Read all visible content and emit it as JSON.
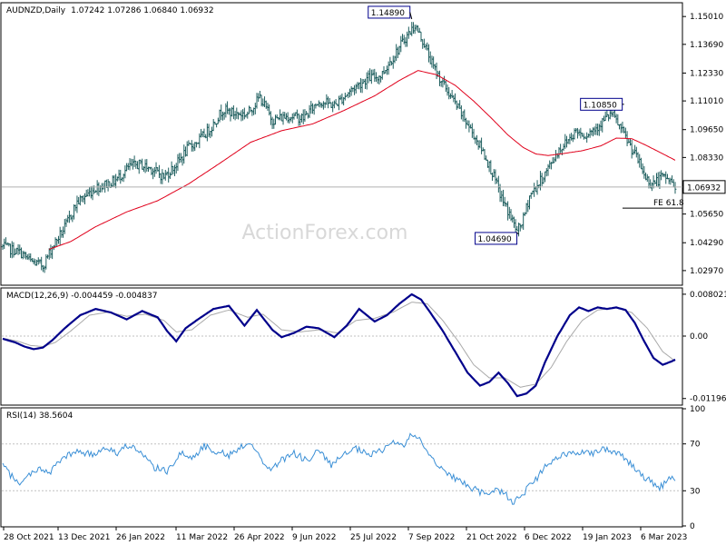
{
  "header": {
    "symbol": "AUDNZD,Daily",
    "ohlc": "1.07242 1.07286 1.06840 1.06932"
  },
  "watermark": "ActionForex.com",
  "colors": {
    "price_bar": "#1f5f5f",
    "ma": "#e0001b",
    "macd_line": "#00008b",
    "signal_line": "#a9a9a9",
    "rsi_line": "#3a8fd6",
    "grid": "#c0c0c0",
    "frame": "#000000",
    "label_border": "#00008b"
  },
  "chart_data": [
    {
      "type": "candlestick",
      "title": "AUDNZD,Daily",
      "ylim": [
        1.0232,
        1.1562
      ],
      "y_ticks": [
        "1.15010",
        "1.13690",
        "1.12330",
        "1.11010",
        "1.09650",
        "1.08330",
        "1.06970",
        "1.05650",
        "1.04290",
        "1.02970"
      ],
      "x_ticks": [
        "28 Oct 2021",
        "13 Dec 2021",
        "26 Jan 2022",
        "11 Mar 2022",
        "26 Apr 2022",
        "9 Jun 2022",
        "25 Jul 2022",
        "7 Sep 2022",
        "21 Oct 2022",
        "6 Dec 2022",
        "19 Jan 2023",
        "6 Mar 2023"
      ],
      "close_keypoints": [
        [
          0,
          1.041
        ],
        [
          12,
          1.038
        ],
        [
          18,
          1.034
        ],
        [
          26,
          1.032
        ],
        [
          32,
          1.041
        ],
        [
          40,
          1.05
        ],
        [
          48,
          1.062
        ],
        [
          60,
          1.069
        ],
        [
          72,
          1.072
        ],
        [
          82,
          1.079
        ],
        [
          88,
          1.08
        ],
        [
          96,
          1.078
        ],
        [
          104,
          1.074
        ],
        [
          112,
          1.08
        ],
        [
          120,
          1.088
        ],
        [
          126,
          1.091
        ],
        [
          134,
          1.097
        ],
        [
          142,
          1.106
        ],
        [
          150,
          1.104
        ],
        [
          158,
          1.104
        ],
        [
          166,
          1.112
        ],
        [
          174,
          1.101
        ],
        [
          184,
          1.103
        ],
        [
          194,
          1.102
        ],
        [
          204,
          1.11
        ],
        [
          214,
          1.108
        ],
        [
          226,
          1.116
        ],
        [
          236,
          1.121
        ],
        [
          244,
          1.122
        ],
        [
          252,
          1.131
        ],
        [
          260,
          1.14
        ],
        [
          266,
          1.146
        ],
        [
          272,
          1.137
        ],
        [
          278,
          1.126
        ],
        [
          286,
          1.116
        ],
        [
          296,
          1.104
        ],
        [
          304,
          1.094
        ],
        [
          310,
          1.086
        ],
        [
          316,
          1.076
        ],
        [
          322,
          1.064
        ],
        [
          328,
          1.055
        ],
        [
          332,
          1.048
        ],
        [
          336,
          1.054
        ],
        [
          340,
          1.065
        ],
        [
          346,
          1.071
        ],
        [
          352,
          1.078
        ],
        [
          358,
          1.086
        ],
        [
          364,
          1.091
        ],
        [
          370,
          1.096
        ],
        [
          376,
          1.094
        ],
        [
          382,
          1.097
        ],
        [
          388,
          1.101
        ],
        [
          393,
          1.104
        ],
        [
          398,
          1.098
        ],
        [
          404,
          1.09
        ],
        [
          410,
          1.082
        ],
        [
          414,
          1.075
        ],
        [
          418,
          1.071
        ],
        [
          422,
          1.072
        ],
        [
          426,
          1.074
        ],
        [
          430,
          1.073
        ],
        [
          434,
          1.069
        ]
      ],
      "ma_keypoints": [
        [
          30,
          1.0398
        ],
        [
          44,
          1.0435
        ],
        [
          60,
          1.0505
        ],
        [
          80,
          1.0575
        ],
        [
          100,
          1.0628
        ],
        [
          120,
          1.0708
        ],
        [
          140,
          1.0805
        ],
        [
          160,
          1.0905
        ],
        [
          180,
          1.096
        ],
        [
          200,
          1.0992
        ],
        [
          220,
          1.1055
        ],
        [
          240,
          1.1125
        ],
        [
          256,
          1.1198
        ],
        [
          268,
          1.1245
        ],
        [
          280,
          1.1225
        ],
        [
          292,
          1.1175
        ],
        [
          304,
          1.11
        ],
        [
          316,
          1.1015
        ],
        [
          326,
          1.094
        ],
        [
          336,
          1.088
        ],
        [
          344,
          1.085
        ],
        [
          352,
          1.0842
        ],
        [
          362,
          1.0852
        ],
        [
          374,
          1.0865
        ],
        [
          386,
          1.0888
        ],
        [
          396,
          1.0925
        ],
        [
          406,
          1.0922
        ],
        [
          414,
          1.0895
        ],
        [
          424,
          1.0858
        ],
        [
          434,
          1.082
        ]
      ],
      "series": [
        {
          "name": "",
          "kind": "ohlc_bars"
        },
        {
          "name": "",
          "kind": "moving_average"
        }
      ],
      "price_labels": [
        {
          "text": "1.14890",
          "bar": 264,
          "value": 1.1489
        },
        {
          "text": "1.10850",
          "bar": 401,
          "value": 1.1085
        },
        {
          "text": "1.04690",
          "bar": 333,
          "value": 1.0469
        }
      ],
      "current_price": "1.06932",
      "current_value": 1.06932,
      "fe_label": "FE 61.8",
      "fe_value": 1.0593,
      "grid": false
    },
    {
      "type": "line",
      "title": "MACD(12,26,9) -0.004459 -0.004837",
      "ylim": [
        -0.01305,
        0.00905
      ],
      "y_ticks": [
        "0.008021",
        "0.00",
        "-0.011962"
      ],
      "y_tick_values": [
        0.008021,
        0.0,
        -0.011962
      ],
      "macd_keypoints": [
        [
          0,
          -0.0005
        ],
        [
          8,
          -0.0012
        ],
        [
          14,
          -0.002
        ],
        [
          20,
          -0.0025
        ],
        [
          26,
          -0.0022
        ],
        [
          32,
          -0.0008
        ],
        [
          40,
          0.0015
        ],
        [
          50,
          0.004
        ],
        [
          60,
          0.0052
        ],
        [
          70,
          0.0045
        ],
        [
          80,
          0.0032
        ],
        [
          90,
          0.0048
        ],
        [
          100,
          0.0036
        ],
        [
          106,
          0.001
        ],
        [
          112,
          -0.001
        ],
        [
          118,
          0.0015
        ],
        [
          126,
          0.0032
        ],
        [
          136,
          0.0052
        ],
        [
          146,
          0.0058
        ],
        [
          156,
          0.002
        ],
        [
          164,
          0.005
        ],
        [
          174,
          0.0012
        ],
        [
          180,
          -0.0002
        ],
        [
          188,
          0.0006
        ],
        [
          196,
          0.0018
        ],
        [
          204,
          0.0015
        ],
        [
          214,
          -0.0002
        ],
        [
          222,
          0.002
        ],
        [
          230,
          0.0052
        ],
        [
          240,
          0.0028
        ],
        [
          248,
          0.004
        ],
        [
          256,
          0.0062
        ],
        [
          264,
          0.008
        ],
        [
          270,
          0.007
        ],
        [
          276,
          0.0045
        ],
        [
          284,
          0.001
        ],
        [
          292,
          -0.003
        ],
        [
          300,
          -0.007
        ],
        [
          308,
          -0.0095
        ],
        [
          314,
          -0.0088
        ],
        [
          320,
          -0.007
        ],
        [
          326,
          -0.009
        ],
        [
          332,
          -0.0115
        ],
        [
          338,
          -0.011
        ],
        [
          344,
          -0.0095
        ],
        [
          350,
          -0.005
        ],
        [
          358,
          0.0
        ],
        [
          366,
          0.004
        ],
        [
          372,
          0.0055
        ],
        [
          378,
          0.0048
        ],
        [
          384,
          0.0055
        ],
        [
          390,
          0.0052
        ],
        [
          396,
          0.0055
        ],
        [
          402,
          0.005
        ],
        [
          408,
          0.0025
        ],
        [
          414,
          -0.001
        ],
        [
          420,
          -0.0042
        ],
        [
          426,
          -0.0055
        ],
        [
          432,
          -0.0048
        ],
        [
          434,
          -0.0045
        ]
      ],
      "signal_keypoints": [
        [
          0,
          -0.0004
        ],
        [
          10,
          -0.001
        ],
        [
          18,
          -0.0018
        ],
        [
          26,
          -0.002
        ],
        [
          34,
          -0.0012
        ],
        [
          44,
          0.001
        ],
        [
          56,
          0.004
        ],
        [
          68,
          0.0046
        ],
        [
          80,
          0.0038
        ],
        [
          92,
          0.0042
        ],
        [
          104,
          0.003
        ],
        [
          112,
          0.0008
        ],
        [
          122,
          0.0012
        ],
        [
          134,
          0.004
        ],
        [
          146,
          0.005
        ],
        [
          158,
          0.0036
        ],
        [
          168,
          0.0042
        ],
        [
          180,
          0.0012
        ],
        [
          192,
          0.0008
        ],
        [
          204,
          0.0012
        ],
        [
          216,
          0.0006
        ],
        [
          228,
          0.003
        ],
        [
          240,
          0.0034
        ],
        [
          252,
          0.0046
        ],
        [
          264,
          0.0065
        ],
        [
          274,
          0.0062
        ],
        [
          284,
          0.003
        ],
        [
          294,
          -0.001
        ],
        [
          304,
          -0.0055
        ],
        [
          314,
          -0.008
        ],
        [
          324,
          -0.008
        ],
        [
          334,
          -0.0098
        ],
        [
          344,
          -0.0092
        ],
        [
          354,
          -0.006
        ],
        [
          364,
          -0.001
        ],
        [
          374,
          0.003
        ],
        [
          384,
          0.005
        ],
        [
          396,
          0.0054
        ],
        [
          406,
          0.0045
        ],
        [
          416,
          0.0015
        ],
        [
          426,
          -0.003
        ],
        [
          434,
          -0.0048
        ]
      ],
      "series": [
        {
          "name": "",
          "kind": "macd"
        },
        {
          "name": "",
          "kind": "signal"
        }
      ],
      "grid": false
    },
    {
      "type": "line",
      "title": "RSI(14) 38.5604",
      "ylim": [
        0,
        100
      ],
      "y_ticks": [
        "100",
        "70",
        "30",
        "0"
      ],
      "y_tick_values": [
        100,
        70,
        30,
        0
      ],
      "levels": [
        70,
        30
      ],
      "rsi_keypoints": [
        [
          0,
          52
        ],
        [
          6,
          42
        ],
        [
          12,
          36
        ],
        [
          18,
          45
        ],
        [
          24,
          50
        ],
        [
          30,
          44
        ],
        [
          36,
          55
        ],
        [
          42,
          60
        ],
        [
          50,
          64
        ],
        [
          58,
          60
        ],
        [
          66,
          68
        ],
        [
          74,
          62
        ],
        [
          82,
          70
        ],
        [
          90,
          60
        ],
        [
          98,
          50
        ],
        [
          106,
          46
        ],
        [
          114,
          62
        ],
        [
          122,
          58
        ],
        [
          130,
          68
        ],
        [
          138,
          64
        ],
        [
          146,
          60
        ],
        [
          154,
          68
        ],
        [
          160,
          72
        ],
        [
          166,
          58
        ],
        [
          172,
          48
        ],
        [
          180,
          56
        ],
        [
          188,
          62
        ],
        [
          196,
          56
        ],
        [
          204,
          64
        ],
        [
          212,
          52
        ],
        [
          220,
          60
        ],
        [
          228,
          66
        ],
        [
          236,
          60
        ],
        [
          244,
          64
        ],
        [
          252,
          72
        ],
        [
          258,
          68
        ],
        [
          264,
          78
        ],
        [
          270,
          72
        ],
        [
          276,
          60
        ],
        [
          284,
          48
        ],
        [
          292,
          40
        ],
        [
          300,
          35
        ],
        [
          306,
          30
        ],
        [
          312,
          26
        ],
        [
          318,
          32
        ],
        [
          324,
          28
        ],
        [
          330,
          20
        ],
        [
          336,
          28
        ],
        [
          342,
          36
        ],
        [
          350,
          50
        ],
        [
          358,
          58
        ],
        [
          366,
          62
        ],
        [
          374,
          64
        ],
        [
          380,
          62
        ],
        [
          386,
          66
        ],
        [
          394,
          64
        ],
        [
          400,
          60
        ],
        [
          406,
          52
        ],
        [
          412,
          44
        ],
        [
          418,
          38
        ],
        [
          424,
          32
        ],
        [
          428,
          38
        ],
        [
          432,
          42
        ],
        [
          434,
          38.56
        ]
      ],
      "series": [
        {
          "name": "",
          "kind": "rsi"
        }
      ],
      "grid": false
    }
  ]
}
